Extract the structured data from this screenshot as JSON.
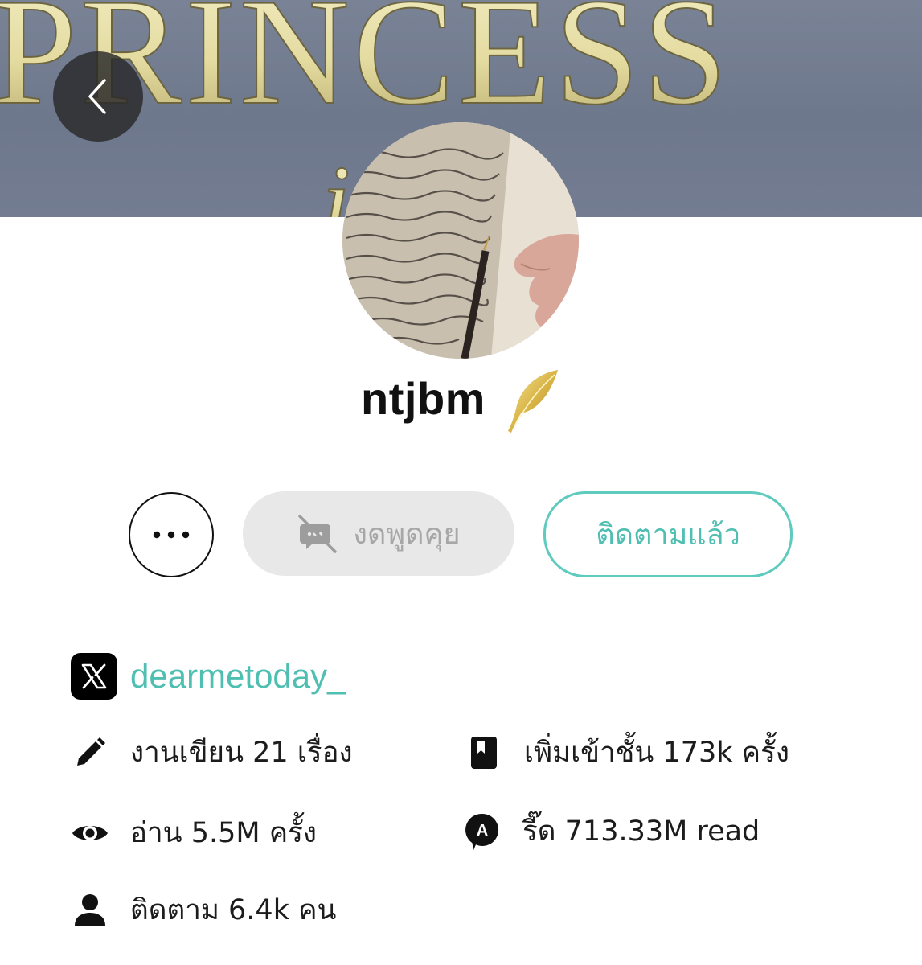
{
  "banner": {
    "title_art": "PRINCESS",
    "subtitle_art": "iaries"
  },
  "profile": {
    "username": "ntjbm"
  },
  "actions": {
    "more_label": "•••",
    "chat_label": "งดพูดคุย",
    "follow_label": "ติดตามแล้ว"
  },
  "social": {
    "x_handle": "dearmetoday_"
  },
  "stats": {
    "works": "งานเขียน 21 เรื่อง",
    "shelf": "เพิ่มเข้าชั้น 173k ครั้ง",
    "reads": "อ่าน 5.5M ครั้ง",
    "read_app": "รี๊ด 713.33M read",
    "followers": "ติดตาม 6.4k คน"
  },
  "colors": {
    "accent": "#4fbfb2",
    "accent_border": "#5fcabe",
    "disabled_bg": "#e8e8e8",
    "disabled_text": "#a7a7a7"
  },
  "icons": [
    "chevron-left-icon",
    "more-dots-icon",
    "chat-off-icon",
    "x-logo-icon",
    "pencil-icon",
    "bookshelf-icon",
    "eye-icon",
    "readapp-icon",
    "person-icon",
    "gold-quill-icon"
  ]
}
